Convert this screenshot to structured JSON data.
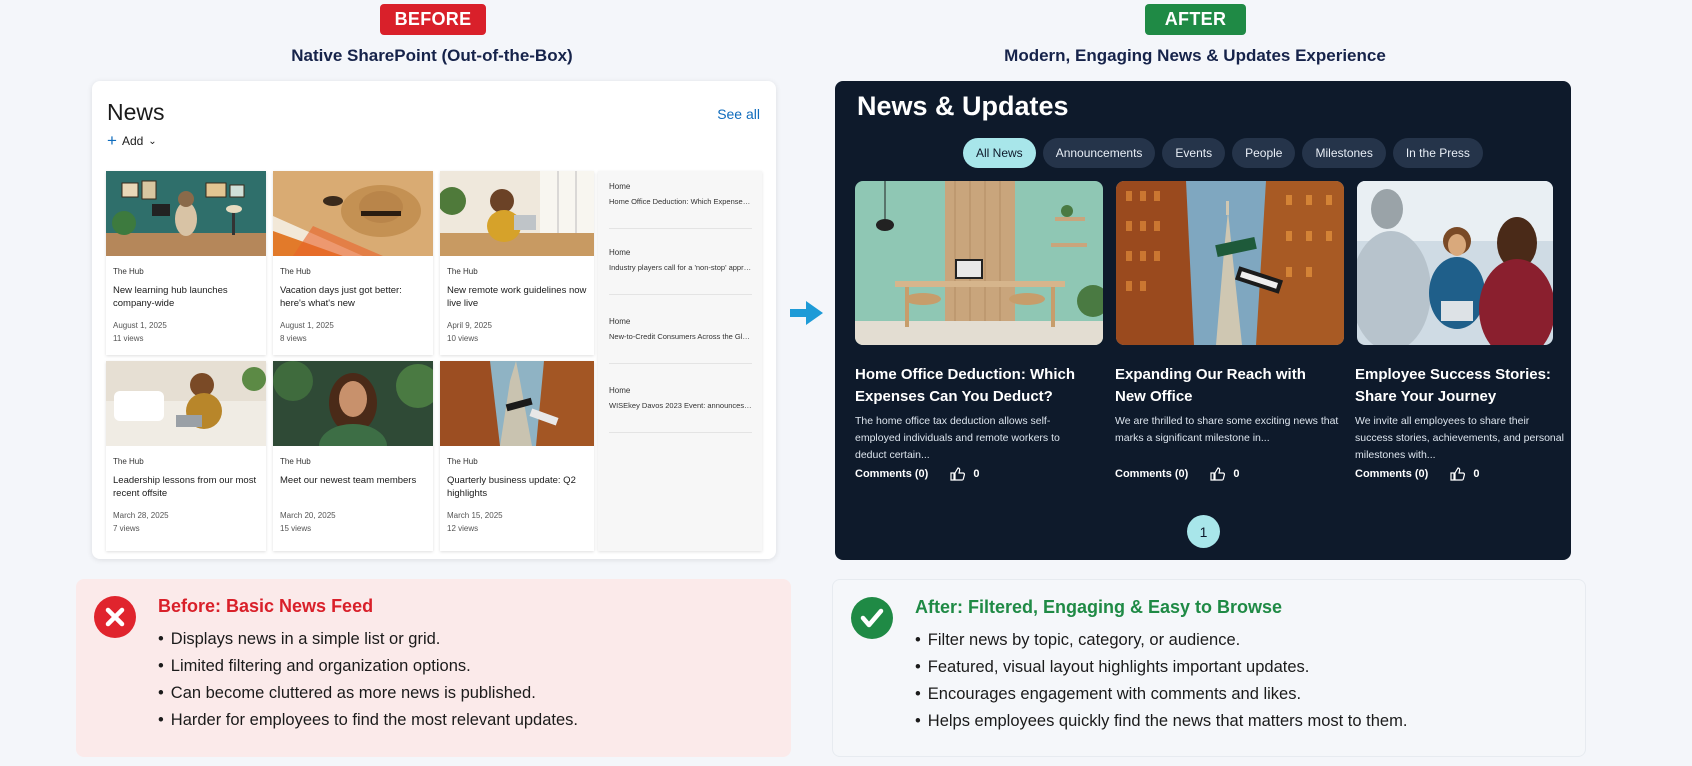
{
  "before": {
    "badge": "BEFORE",
    "subtitle": "Native SharePoint (Out-of-the-Box)",
    "webpart": {
      "title": "News",
      "see_all": "See all",
      "add_label": "Add",
      "tiles": [
        {
          "site": "The Hub",
          "title": "New learning hub launches company-wide",
          "date": "August 1, 2025",
          "views": "11 views"
        },
        {
          "site": "The Hub",
          "title": "Vacation days just got better: here's what's new",
          "date": "August 1, 2025",
          "views": "8 views"
        },
        {
          "site": "The Hub",
          "title": "New remote work guidelines now live live",
          "date": "April 9, 2025",
          "views": "10 views"
        },
        {
          "site": "The Hub",
          "title": "Leadership lessons from our most recent offsite",
          "date": "March 28, 2025",
          "views": "7 views"
        },
        {
          "site": "The Hub",
          "title": "Meet our newest team members",
          "date": "March 20, 2025",
          "views": "15 views"
        },
        {
          "site": "The Hub",
          "title": "Quarterly business update: Q2 highlights",
          "date": "March 15, 2025",
          "views": "12 views"
        }
      ],
      "list": [
        {
          "site": "Home",
          "title": "Home Office Deduction: Which Expenses C..."
        },
        {
          "site": "Home",
          "title": "Industry players call for a 'non-stop' appro..."
        },
        {
          "site": "Home",
          "title": "New-to-Credit Consumers Across the Glob..."
        },
        {
          "site": "Home",
          "title": "WISEkey Davos 2023 Event: announces the ..."
        }
      ]
    },
    "panel": {
      "heading": "Before: Basic News Feed",
      "points": [
        "Displays news in a simple list or grid.",
        "Limited filtering and organization options.",
        "Can become cluttered as more news is published.",
        "Harder for employees to find the most relevant updates."
      ]
    }
  },
  "after": {
    "badge": "AFTER",
    "subtitle": "Modern, Engaging News & Updates Experience",
    "webpart": {
      "title": "News & Updates",
      "tabs": [
        "All News",
        "Announcements",
        "Events",
        "People",
        "Milestones",
        "In the Press"
      ],
      "active_tab": "All News",
      "cards": [
        {
          "title": "Home Office Deduction: Which Expenses Can You Deduct?",
          "excerpt": "The home office tax deduction allows self-employed individuals and remote workers to deduct certain...",
          "comments": "Comments (0)",
          "likes": "0"
        },
        {
          "title": "Expanding Our Reach with New Office",
          "excerpt": "We are thrilled to share some exciting news that marks a significant milestone in...",
          "comments": "Comments (0)",
          "likes": "0"
        },
        {
          "title": "Employee Success Stories: Share Your Journey",
          "excerpt": "We invite all employees to share their success stories, achievements, and personal milestones with...",
          "comments": "Comments (0)",
          "likes": "0"
        }
      ],
      "page": "1"
    },
    "panel": {
      "heading": "After: Filtered, Engaging & Easy to Browse",
      "points": [
        "Filter news by topic, category, or audience.",
        "Featured, visual layout highlights important updates.",
        "Encourages engagement with comments and likes.",
        "Helps employees quickly find the news that matters most to them."
      ]
    }
  },
  "colors": {
    "before_red": "#d9202a",
    "after_green": "#1f8a45",
    "dark_panel": "#0e1a2b",
    "accent_teal": "#a8e6ea",
    "sharepoint_blue": "#0f6cbd"
  }
}
